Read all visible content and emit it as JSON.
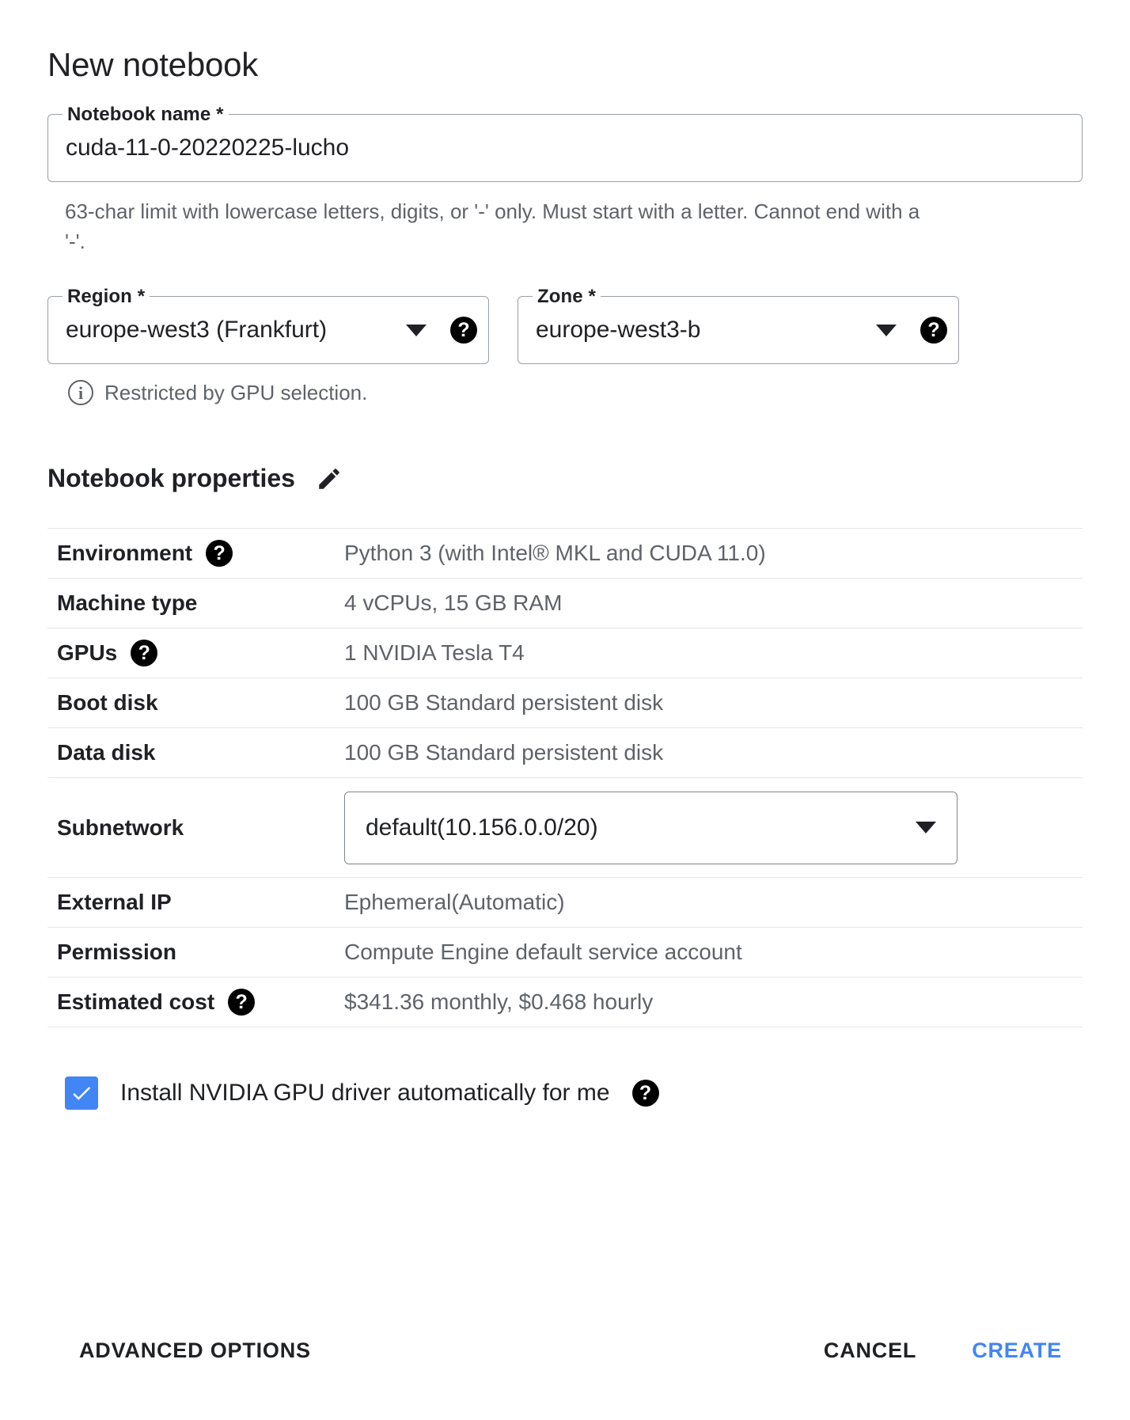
{
  "page": {
    "title": "New notebook"
  },
  "notebook_name": {
    "label": "Notebook name *",
    "value": "cuda-11-0-20220225-lucho",
    "placeholder": "Notebook name",
    "helper": "63-char limit with lowercase letters, digits, or '-' only. Must start with a letter. Cannot end with a '-'."
  },
  "region": {
    "label": "Region *",
    "value": "europe-west3 (Frankfurt)",
    "help_glyph": "?"
  },
  "zone": {
    "label": "Zone *",
    "value": "europe-west3-b",
    "help_glyph": "?"
  },
  "restricted_note": {
    "text": "Restricted by GPU selection.",
    "icon_glyph": "i"
  },
  "properties": {
    "title": "Notebook properties",
    "edit_icon": "pencil-icon",
    "rows": [
      {
        "label": "Environment",
        "value": "Python 3 (with Intel® MKL and CUDA 11.0)",
        "help": true
      },
      {
        "label": "Machine type",
        "value": "4 vCPUs, 15 GB RAM",
        "help": false
      },
      {
        "label": "GPUs",
        "value": "1 NVIDIA Tesla T4",
        "help": true
      },
      {
        "label": "Boot disk",
        "value": "100 GB Standard persistent disk",
        "help": false
      },
      {
        "label": "Data disk",
        "value": "100 GB Standard persistent disk",
        "help": false
      }
    ],
    "subnetwork": {
      "label": "Subnetwork",
      "value": "default(10.156.0.0/20)"
    },
    "rows_after": [
      {
        "label": "External IP",
        "value": "Ephemeral(Automatic)",
        "help": false
      },
      {
        "label": "Permission",
        "value": "Compute Engine default service account",
        "help": false
      },
      {
        "label": "Estimated cost",
        "value": "$341.36 monthly, $0.468 hourly",
        "help": true
      }
    ]
  },
  "gpu_driver": {
    "label": "Install NVIDIA GPU driver automatically for me",
    "checked": true,
    "help_glyph": "?"
  },
  "footer": {
    "advanced_options": "ADVANCED OPTIONS",
    "cancel": "CANCEL",
    "create": "CREATE"
  },
  "colors": {
    "accent": "#4285f4",
    "text": "#202124",
    "muted": "#5f6368",
    "border": "#9aa0a6",
    "divider": "#e4e6e8"
  }
}
